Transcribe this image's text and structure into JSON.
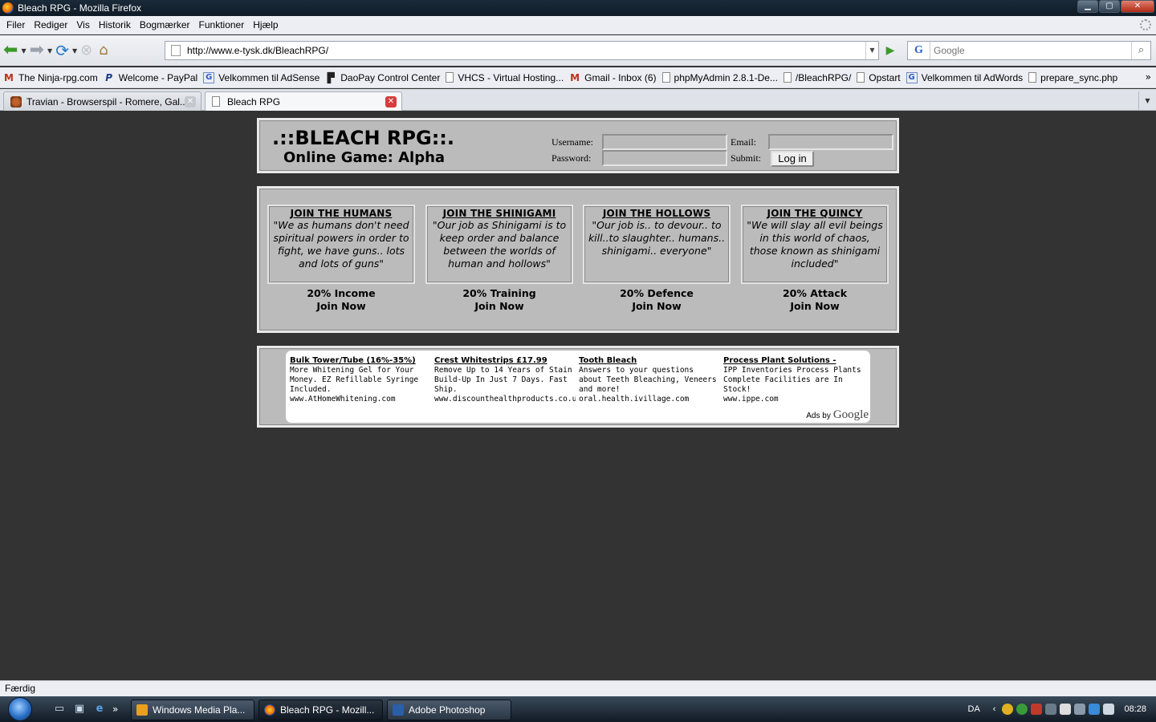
{
  "window": {
    "title": "Bleach RPG - Mozilla Firefox",
    "min": "▁",
    "max": "▢",
    "close": "✕"
  },
  "menu": [
    "Filer",
    "Rediger",
    "Vis",
    "Historik",
    "Bogmærker",
    "Funktioner",
    "Hjælp"
  ],
  "nav": {
    "url": "http://www.e-tysk.dk/BleachRPG/",
    "search_placeholder": "Google"
  },
  "bookmarks": [
    {
      "label": "The Ninja-rpg.com",
      "icon": "gmail-icon"
    },
    {
      "label": "Welcome - PayPal",
      "icon": "paypal-icon"
    },
    {
      "label": "Velkommen til AdSense",
      "icon": "google-icon"
    },
    {
      "label": "DaoPay Control Center",
      "icon": "daopay-icon"
    },
    {
      "label": "VHCS - Virtual Hosting...",
      "icon": "file-icon"
    },
    {
      "label": "Gmail - Inbox (6)",
      "icon": "gmail-icon"
    },
    {
      "label": "phpMyAdmin 2.8.1-De...",
      "icon": "file-icon"
    },
    {
      "label": "/BleachRPG/",
      "icon": "file-icon"
    },
    {
      "label": "Opstart",
      "icon": "file-icon"
    },
    {
      "label": "Velkommen til AdWords",
      "icon": "google-icon"
    },
    {
      "label": "prepare_sync.php",
      "icon": "file-icon"
    }
  ],
  "tabs": [
    {
      "label": "Travian - Browserspil - Romere, Gal...",
      "active": false
    },
    {
      "label": "Bleach RPG",
      "active": true
    }
  ],
  "page": {
    "logo_title": ".::BLEACH RPG::.",
    "logo_sub": "Online Game: Alpha",
    "login": {
      "username_label": "Username:",
      "password_label": "Password:",
      "email_label": "Email:",
      "submit_label": "Submit:",
      "button": "Log in",
      "username_value": "",
      "password_value": "",
      "email_value": ""
    },
    "factions": [
      {
        "title": "JOIN THE HUMANS",
        "quote": "\"We as humans don't need spiritual powers in order to fight, we have guns.. lots and lots of guns\"",
        "bonus": "20% Income",
        "join": "Join Now"
      },
      {
        "title": "JOIN THE SHINIGAMI",
        "quote": "\"Our job as Shinigami is to keep order and balance between the worlds of human and hollows\"",
        "bonus": "20% Training",
        "join": "Join Now"
      },
      {
        "title": "JOIN THE HOLLOWS",
        "quote": "\"Our job is.. to devour.. to kill..to slaughter.. humans.. shinigami.. everyone\"",
        "bonus": "20% Defence",
        "join": "Join Now"
      },
      {
        "title": "JOIN THE QUINCY",
        "quote": "\"We will slay all evil beings in this world of chaos, those known as shinigami included\"",
        "bonus": "20% Attack",
        "join": "Join Now"
      }
    ],
    "ads": [
      {
        "title": "Bulk Tower/Tube (16%-35%)",
        "text": "More Whitening Gel for Your Money. EZ Refillable Syringe Included.",
        "url": "www.AtHomeWhitening.com"
      },
      {
        "title": "Crest Whitestrips £17.99",
        "text": "Remove Up to 14 Years of Stain Build-Up In Just 7 Days. Fast Ship.",
        "url": "www.discounthealthproducts.co.uk"
      },
      {
        "title": "Tooth Bleach",
        "text": "Answers to your questions about Teeth Bleaching, Veneers and more!",
        "url": "oral.health.ivillage.com"
      },
      {
        "title": "Process Plant Solutions -",
        "text": "IPP Inventories Process Plants Complete Facilities are In Stock!",
        "url": "www.ippe.com"
      }
    ],
    "ads_by": "Ads by",
    "ads_google": "Google"
  },
  "status": "Færdig",
  "taskbar": {
    "tasks": [
      {
        "label": "Windows Media Pla..."
      },
      {
        "label": "Bleach RPG - Mozill..."
      },
      {
        "label": "Adobe Photoshop"
      }
    ],
    "lang": "DA",
    "clock": "08:28"
  }
}
